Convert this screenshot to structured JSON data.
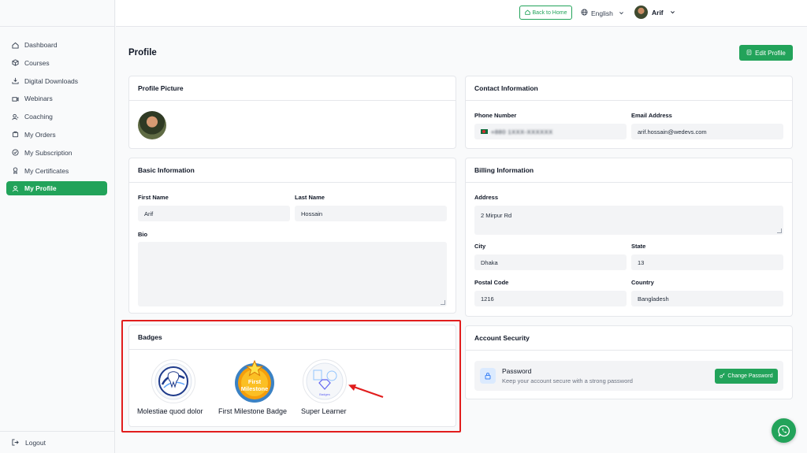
{
  "sidebar": {
    "items": [
      {
        "label": "Dashboard",
        "icon": "home-icon"
      },
      {
        "label": "Courses",
        "icon": "cube-icon"
      },
      {
        "label": "Digital Downloads",
        "icon": "download-icon"
      },
      {
        "label": "Webinars",
        "icon": "video-icon"
      },
      {
        "label": "Coaching",
        "icon": "coaching-icon"
      },
      {
        "label": "My Orders",
        "icon": "cart-icon"
      },
      {
        "label": "My Subscription",
        "icon": "check-circle-icon"
      },
      {
        "label": "My Certificates",
        "icon": "award-icon"
      },
      {
        "label": "My Profile",
        "icon": "user-icon",
        "active": true
      }
    ],
    "logout_label": "Logout"
  },
  "header": {
    "back_home_label": "Back to Home",
    "language": "English",
    "user_name": "Arif"
  },
  "page": {
    "title": "Profile",
    "edit_label": "Edit Profile"
  },
  "profile_picture": {
    "title": "Profile Picture"
  },
  "basic_info": {
    "title": "Basic Information",
    "first_name_label": "First Name",
    "first_name": "Arif",
    "last_name_label": "Last Name",
    "last_name": "Hossain",
    "bio_label": "Bio",
    "bio": ""
  },
  "badges": {
    "title": "Badges",
    "items": [
      {
        "label": "Molestiae quod dolor"
      },
      {
        "label": "First Milestone Badge",
        "badge_text": "First Milestone"
      },
      {
        "label": "Super Learner",
        "badge_text": "Badges"
      }
    ]
  },
  "contact": {
    "title": "Contact Information",
    "phone_label": "Phone Number",
    "phone_value": "+880 1XXX-XXXXXX",
    "email_label": "Email Address",
    "email_value": "arif.hossain@wedevs.com"
  },
  "billing": {
    "title": "Billing Information",
    "address_label": "Address",
    "address": "2 Mirpur Rd",
    "city_label": "City",
    "city": "Dhaka",
    "state_label": "State",
    "state": "13",
    "postal_label": "Postal Code",
    "postal": "1216",
    "country_label": "Country",
    "country": "Bangladesh"
  },
  "security": {
    "title": "Account Security",
    "password_title": "Password",
    "password_desc": "Keep your account secure with a strong password",
    "change_label": "Change Password"
  },
  "colors": {
    "accent": "#22a35a",
    "highlight": "#e11d1d"
  }
}
